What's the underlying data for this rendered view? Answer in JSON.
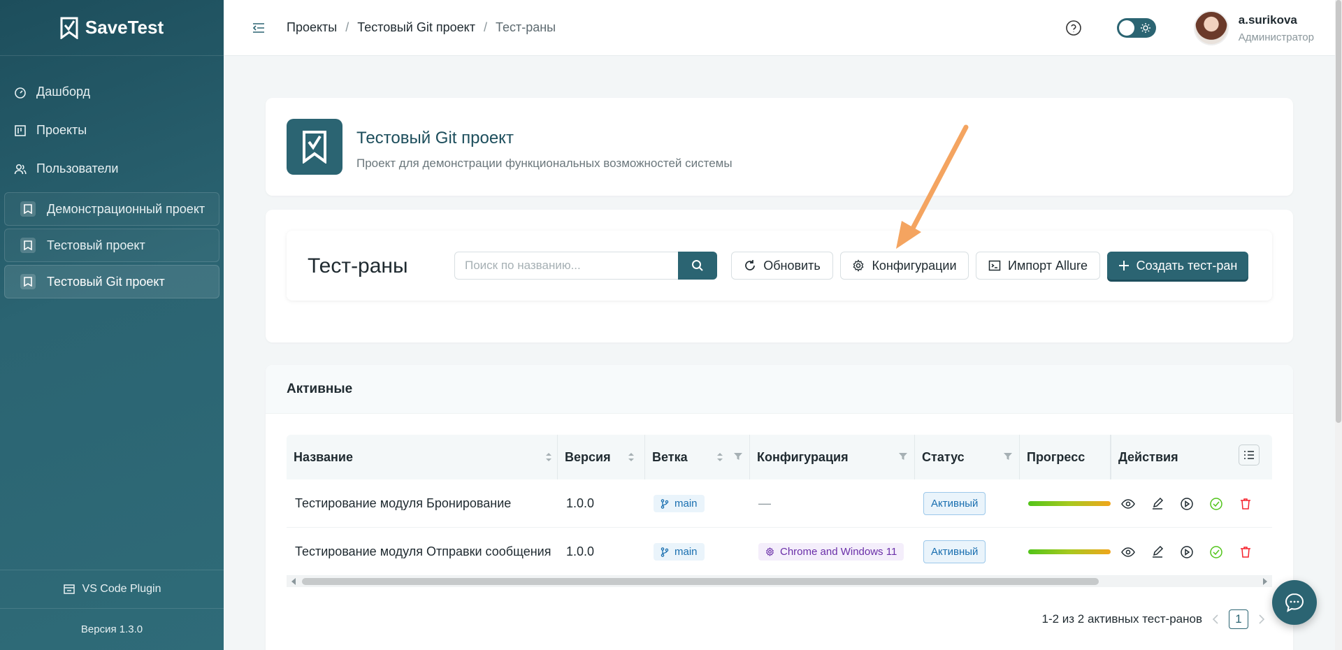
{
  "app": {
    "name": "SaveTest"
  },
  "sidebar": {
    "nav": [
      {
        "label": "Дашборд",
        "icon": "dashboard-icon"
      },
      {
        "label": "Проекты",
        "icon": "projects-icon"
      },
      {
        "label": "Пользователи",
        "icon": "users-icon"
      }
    ],
    "projects": [
      {
        "label": "Демонстрационный проект"
      },
      {
        "label": "Тестовый проект"
      },
      {
        "label": "Тестовый Git проект",
        "active": true
      }
    ],
    "plugin_label": "VS Code Plugin",
    "version_label": "Версия 1.3.0"
  },
  "header": {
    "breadcrumb": [
      "Проекты",
      "Тестовый Git проект",
      "Тест-раны"
    ],
    "user": {
      "name": "a.surikova",
      "role": "Администратор"
    }
  },
  "project": {
    "title": "Тестовый Git проект",
    "description": "Проект для демонстрации функциональных возможностей системы"
  },
  "testruns": {
    "title": "Тест-раны",
    "search_placeholder": "Поиск по названию...",
    "refresh_label": "Обновить",
    "configs_label": "Конфигурации",
    "import_label": "Импорт Allure",
    "create_label": "Создать тест-ран"
  },
  "active": {
    "title": "Активные",
    "columns": [
      "Название",
      "Версия",
      "Ветка",
      "Конфигурация",
      "Статус",
      "Прогресс",
      "Действия"
    ],
    "rows": [
      {
        "name": "Тестирование модуля Бронирование",
        "version": "1.0.0",
        "branch": "main",
        "config": "—",
        "status": "Активный",
        "progress": 1.0
      },
      {
        "name": "Тестирование модуля Отправки сообщения",
        "version": "1.0.0",
        "branch": "main",
        "config": "Chrome and Windows 11",
        "status": "Активный",
        "progress": 1.0
      }
    ],
    "pagination": {
      "summary": "1-2 из 2 активных тест-ранов",
      "page": "1"
    }
  },
  "colors": {
    "primary": "#2b6472",
    "sidebar_dark": "#1d4e5c",
    "annotation_arrow": "#f4a460"
  }
}
